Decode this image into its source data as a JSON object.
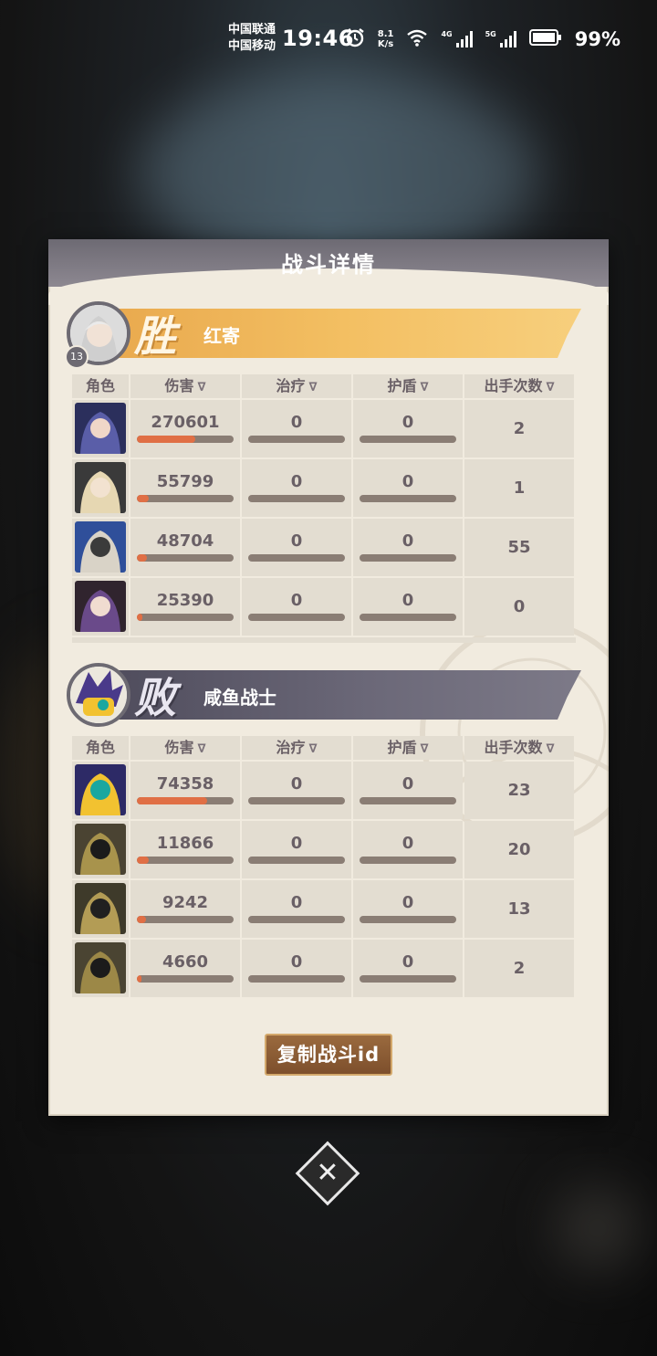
{
  "status_bar": {
    "carrier1": "中国联通",
    "carrier2": "中国移动",
    "time": "19:46",
    "net_speed_value": "8.1",
    "net_speed_unit": "K/s",
    "gen1": "4G",
    "gen2": "5G",
    "battery": "99%"
  },
  "dialog": {
    "title": "战斗详情",
    "copy_button": "复制战斗id"
  },
  "columns": [
    "角色",
    "伤害",
    "治疗",
    "护盾",
    "出手次数"
  ],
  "sort_glyph": "∇",
  "teams": [
    {
      "result": "胜",
      "player_name": "红寄",
      "level": "13",
      "rows": [
        {
          "damage": "270601",
          "damage_fraction": 0.6,
          "heal": "0",
          "shield": "0",
          "actions": "2"
        },
        {
          "damage": "55799",
          "damage_fraction": 0.12,
          "heal": "0",
          "shield": "0",
          "actions": "1"
        },
        {
          "damage": "48704",
          "damage_fraction": 0.1,
          "heal": "0",
          "shield": "0",
          "actions": "55"
        },
        {
          "damage": "25390",
          "damage_fraction": 0.06,
          "heal": "0",
          "shield": "0",
          "actions": "0"
        }
      ]
    },
    {
      "result": "败",
      "player_name": "咸鱼战士",
      "level": "",
      "rows": [
        {
          "damage": "74358",
          "damage_fraction": 0.73,
          "heal": "0",
          "shield": "0",
          "actions": "23"
        },
        {
          "damage": "11866",
          "damage_fraction": 0.12,
          "heal": "0",
          "shield": "0",
          "actions": "20"
        },
        {
          "damage": "9242",
          "damage_fraction": 0.09,
          "heal": "0",
          "shield": "0",
          "actions": "13"
        },
        {
          "damage": "4660",
          "damage_fraction": 0.05,
          "heal": "0",
          "shield": "0",
          "actions": "2"
        }
      ]
    }
  ],
  "colors": {
    "win_banner": "#f3bf62",
    "lose_banner": "#6b6878",
    "damage_bar": "#e06f45",
    "bar_track": "#8a7d74",
    "cell_bg": "#e3ddd1",
    "panel_bg": "#f1ebdf"
  }
}
